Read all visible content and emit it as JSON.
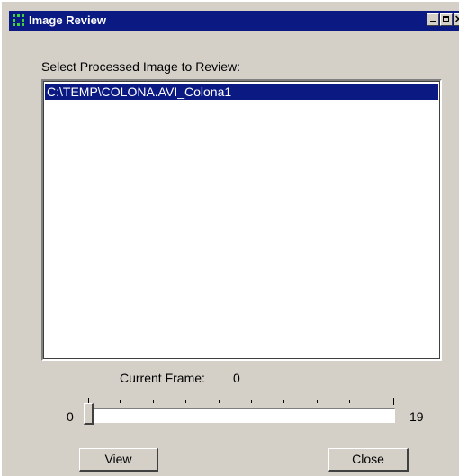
{
  "window": {
    "title": "Image Review",
    "icon": "app-grid-icon",
    "controls": {
      "minimize": "minimize-icon",
      "maximize": "maximize-icon",
      "close": "✕"
    },
    "title_bar_color": "#0a1a82"
  },
  "prompt": "Select Processed Image to Review:",
  "image_list": {
    "items": [
      "C:\\TEMP\\COLONA.AVI_Colona1"
    ],
    "selected_index": 0
  },
  "frame": {
    "label": "Current Frame:",
    "value": "0"
  },
  "slider": {
    "min_label": "0",
    "max_label": "19",
    "value": 0
  },
  "buttons": {
    "view": "View",
    "close": "Close"
  }
}
